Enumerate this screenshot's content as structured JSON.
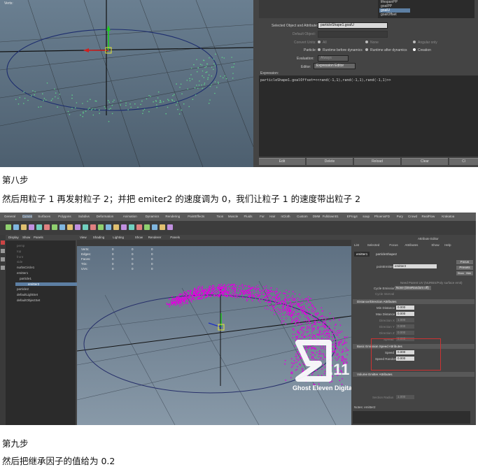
{
  "screenshot1": {
    "viewport": {
      "hud_label": "Verts:"
    },
    "editor": {
      "attribute_list": [
        "lifespanPP",
        "goalPP",
        "goalU",
        "goalOffset"
      ],
      "selected_label": "Selected Object and Attribute:",
      "selected_value": "particleShape1.goalU",
      "default_object_label": "Default Object:",
      "convert_units_label": "Convert Units:",
      "convert_options": [
        "All",
        "None",
        "Angular only"
      ],
      "particle_label": "Particle:",
      "particle_options": [
        "Runtime before dynamics",
        "Runtime after dynamics",
        "Creation"
      ],
      "evaluation_label": "Evaluation:",
      "evaluation_value": "Always",
      "editor_label": "Editor:",
      "editor_value": "Expression Editor",
      "expression_label": "Expression:",
      "expression_text": "particleShape1.goalOffset=<<rand(-1,1),rand(-1,1),rand(-1,1)>>",
      "buttons": [
        "Edit",
        "Delete",
        "Reload",
        "Clear",
        "Cl"
      ]
    }
  },
  "step8_title": "第八步",
  "step8_text": "然后用粒子 1 再发射粒子 2；并把 emiter2 的速度调为 0，我们让粒子 1 的速度带出粒子 2",
  "screenshot2": {
    "shelf_tabs": [
      "General",
      "Curves",
      "Surfaces",
      "Polygons",
      "Subdivs",
      "Deformation",
      "Animation",
      "Dynamics",
      "Rendering",
      "PaintEffects",
      "Toon",
      "Muscle",
      "Fluids",
      "Fur",
      "Hair",
      "nCloth",
      "Custom",
      "DMM",
      "Fulldown01",
      "EProg4",
      "soup",
      "PhoenixFD",
      "Pury",
      "Crowd",
      "RealFlow",
      "Krakatoa"
    ],
    "outliner_menu": [
      "Display",
      "Show",
      "Panels"
    ],
    "outliner_items": [
      "persp",
      "top",
      "front",
      "side",
      "nurbsCircle1",
      "emitter1",
      "particle1",
      "emitter2",
      "particle2",
      "defaultLightSet",
      "defaultObjectSet"
    ],
    "viewport_menu": [
      "View",
      "Shading",
      "Lighting",
      "Show",
      "Renderer",
      "Panels"
    ],
    "viewport_hud": [
      "Verts:",
      "Edges:",
      "Faces:",
      "Tris:",
      "UVs:"
    ],
    "ae": {
      "title": "Attribute Editor",
      "menu": [
        "List",
        "Selected",
        "Focus",
        "Attributes",
        "Show",
        "Help"
      ],
      "tabs": [
        "emitter1",
        "particleShape2"
      ],
      "node_label": "pointEmitter:",
      "node_value": "emitter2",
      "buttons": [
        "Focus",
        "Presets",
        "Show",
        "Hide"
      ],
      "need_parent_uv": "Need Parent UV (NURBS/Poly surface emit)",
      "cycle_emission_label": "Cycle Emission",
      "cycle_emission_value": "None (timeRandom off)",
      "cycle_interval_label": "Cycle Interval",
      "section_distance": "Distance/Direction Attributes",
      "min_distance_label": "Min Distance",
      "min_distance_value": "0.000",
      "max_distance_label": "Max Distance",
      "max_distance_value": "0.000",
      "dir_x_label": "Direction X",
      "dir_x_value": "1.000",
      "dir_y_label": "Direction Y",
      "dir_y_value": "0.000",
      "dir_z_label": "Direction Z",
      "dir_z_value": "0.000",
      "spread_label": "Spread",
      "spread_value": "0.000",
      "section_speed": "Basic Emission Speed Attributes",
      "speed_label": "Speed",
      "speed_value": "0.000",
      "speed_random_label": "Speed Random",
      "speed_random_value": "0.000",
      "section_volume": "Volume Emitter Attributes",
      "section_radius_label": "Section Radius",
      "section_radius_value": "1.000",
      "notes_label": "Notes: emitter2"
    },
    "watermark_text": "Ghost Eleven Digital Video Studio",
    "logo_text": ".11"
  },
  "step9_title": "第九步",
  "step9_text": "然后把继承因子的值给为 0.2",
  "colors": {
    "particles1": "#5fd08a",
    "particles2": "#e000e0",
    "ui_dark": "#444444"
  }
}
